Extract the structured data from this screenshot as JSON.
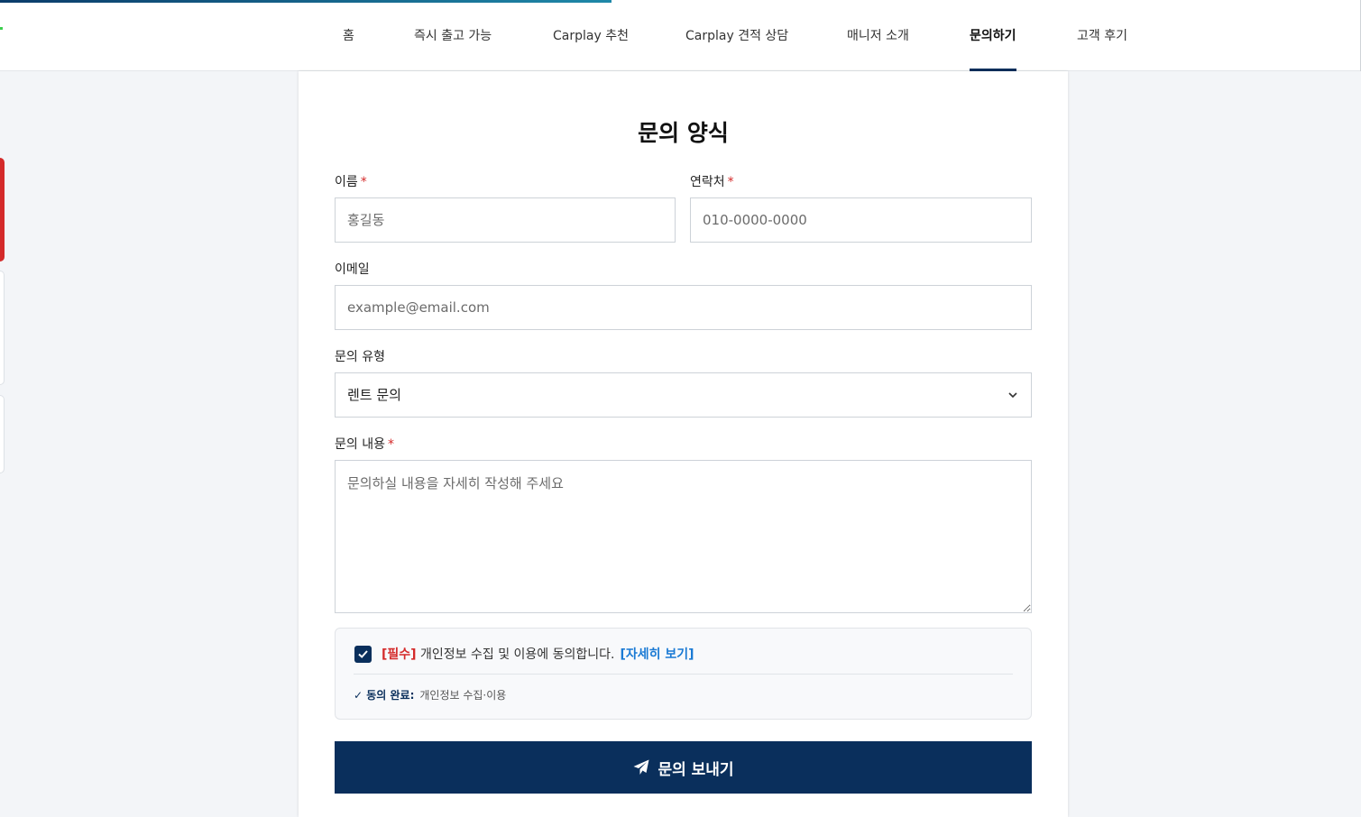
{
  "nav": {
    "items": [
      {
        "label": "홈"
      },
      {
        "label": "즉시 출고 가능"
      },
      {
        "label": "Carplay 추천"
      },
      {
        "label": "Carplay 견적 상담"
      },
      {
        "label": "매니저 소개"
      },
      {
        "label": "문의하기",
        "active": true
      },
      {
        "label": "고객 후기"
      }
    ]
  },
  "form": {
    "title": "문의 양식",
    "name": {
      "label": "이름",
      "required": "*",
      "placeholder": "홍길동"
    },
    "phone": {
      "label": "연락처",
      "required": "*",
      "placeholder": "010-0000-0000"
    },
    "email": {
      "label": "이메일",
      "placeholder": "example@email.com"
    },
    "type": {
      "label": "문의 유형",
      "selected": "렌트 문의"
    },
    "content": {
      "label": "문의 내용",
      "required": "*",
      "placeholder": "문의하실 내용을 자세히 작성해 주세요"
    },
    "consent": {
      "tag": "[필수]",
      "text": " 개인정보 수집 및 이용에 동의합니다.",
      "detail_link": "[자세히 보기]",
      "done_label": "✓ 동의 완료:",
      "done_desc": "개인정보 수집·이용",
      "checked": true
    },
    "submit_label": "문의 보내기"
  },
  "colors": {
    "primary": "#0a2f5c",
    "required": "#d42a2a",
    "link": "#1a7ad4"
  },
  "icons": {
    "submit": "paper-plane-icon",
    "select": "chevron-down-icon",
    "checkbox": "check-icon"
  }
}
